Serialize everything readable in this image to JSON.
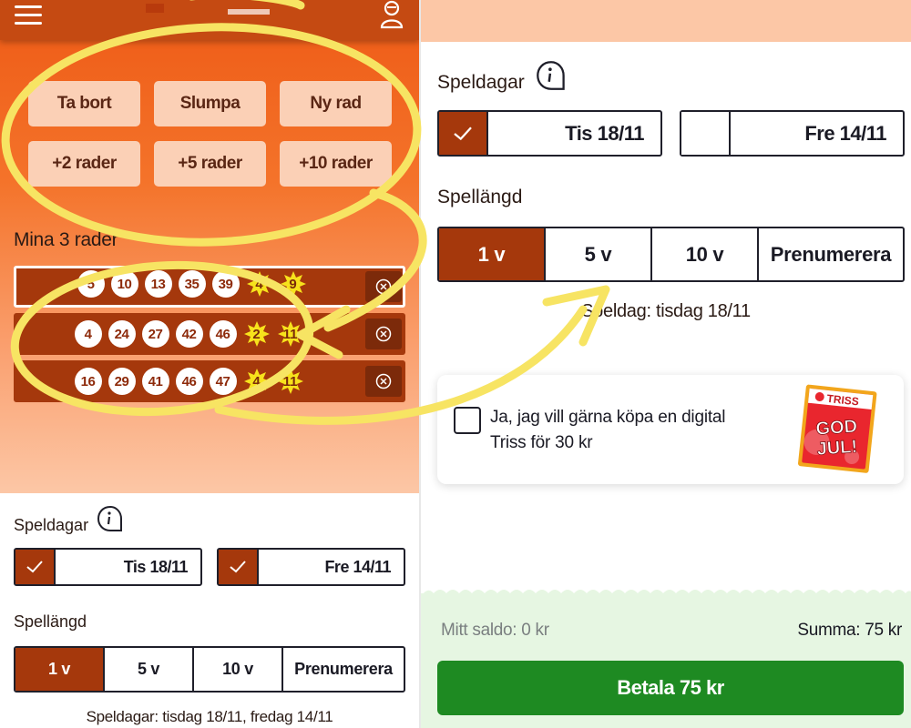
{
  "left": {
    "actions": [
      "Ta bort",
      "Slumpa",
      "Ny rad",
      "+2 rader",
      "+5 rader",
      "+10 rader"
    ],
    "rows_title": "Mina 3 rader",
    "rows": [
      {
        "numbers": [
          "5",
          "10",
          "13",
          "35",
          "39"
        ],
        "stars": [
          "4",
          "9"
        ]
      },
      {
        "numbers": [
          "4",
          "24",
          "27",
          "42",
          "46"
        ],
        "stars": [
          "2",
          "11"
        ]
      },
      {
        "numbers": [
          "16",
          "29",
          "41",
          "46",
          "47"
        ],
        "stars": [
          "4",
          "11"
        ]
      }
    ],
    "speldagar_label": "Speldagar",
    "days": [
      "Tis 18/11",
      "Fre 14/11"
    ],
    "spellangd_label": "Spellängd",
    "durations": [
      "1 v",
      "5 v",
      "10 v",
      "Prenumerera"
    ],
    "summary": "Speldagar: tisdag 18/11, fredag 14/11"
  },
  "right": {
    "speldagar_label": "Speldagar",
    "days": [
      "Tis 18/11",
      "Fre 14/11"
    ],
    "spellangd_label": "Spellängd",
    "durations": [
      "1 v",
      "5 v",
      "10 v",
      "Prenumerera"
    ],
    "summary": "Speldag: tisdag 18/11",
    "triss": {
      "text": "Ja, jag vill gärna köpa en digital Triss för 30 kr",
      "brand": "TRISS",
      "img_text_1": "GOD",
      "img_text_2": "JUL!"
    },
    "balance": "Mitt saldo: 0 kr",
    "sum": "Summa: 75 kr",
    "pay_button": "Betala 75 kr"
  },
  "colors": {
    "primary": "#a5380c",
    "orange": "#ee5a16",
    "pay": "#1e8a22",
    "annotation": "#f7e463"
  }
}
